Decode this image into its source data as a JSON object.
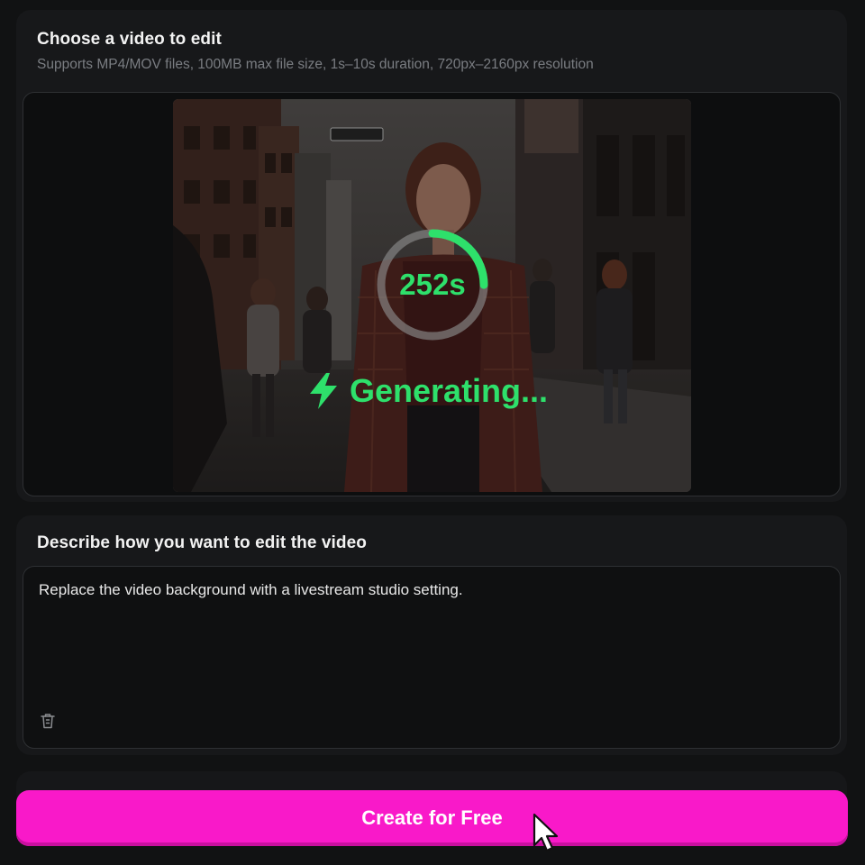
{
  "upload_card": {
    "title": "Choose a video to edit",
    "subtitle": "Supports MP4/MOV files, 100MB max file size, 1s–10s duration, 720px–2160px resolution"
  },
  "generation": {
    "timer_label": "252s",
    "progress_fraction": 0.25,
    "status_label": "Generating...",
    "status_icon": "lightning-bolt-icon",
    "accent_color": "#2ee06b"
  },
  "prompt_card": {
    "title": "Describe how you want to edit the video",
    "prompt_value": "Replace the video background with a livestream studio setting.",
    "clear_icon": "trash-icon"
  },
  "cta": {
    "label": "Create for Free",
    "color": "#f919c9"
  }
}
